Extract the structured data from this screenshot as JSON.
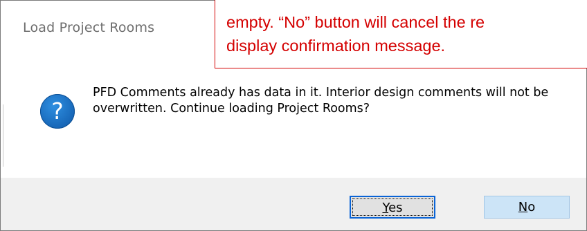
{
  "dialog": {
    "title": "Load Project Rooms",
    "message": "PFD Comments already has data in it.  Interior design comments will not be overwritten.  Continue loading Project Rooms?",
    "icon": "question-icon",
    "icon_glyph": "?",
    "buttons": {
      "yes": {
        "label": "Yes",
        "mnemonic": "Y",
        "rest": "es"
      },
      "no": {
        "label": "No",
        "mnemonic": "N",
        "rest": "o"
      }
    }
  },
  "callout": {
    "line1": "empty.  “No” button will cancel the re",
    "line2": "display confirmation message.",
    "color": "#d40000"
  },
  "colors": {
    "accent": "#0a64d6",
    "footer": "#f0f0f0",
    "icon": "#1767b8"
  }
}
